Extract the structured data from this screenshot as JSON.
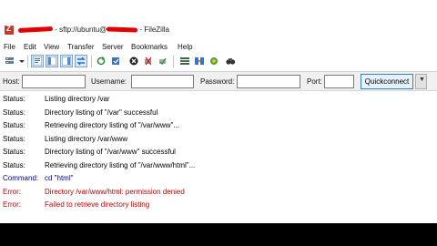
{
  "window": {
    "title_mid": "- sftp://ubuntu@",
    "title_end": "- FileZilla"
  },
  "menu": [
    "File",
    "Edit",
    "View",
    "Transfer",
    "Server",
    "Bookmarks",
    "Help"
  ],
  "toolbar_icons": [
    "site-manager-icon",
    "toggle-message-log-icon",
    "toggle-local-tree-icon",
    "toggle-remote-tree-icon",
    "toggle-transfer-queue-icon",
    "refresh-icon",
    "process-queue-icon",
    "cancel-icon",
    "disconnect-icon",
    "reconnect-icon",
    "filter-icon",
    "compare-icon",
    "sync-browse-icon",
    "search-icon"
  ],
  "quickconnect": {
    "host_label": "Host:",
    "host_value": "",
    "username_label": "Username:",
    "username_value": "",
    "password_label": "Password:",
    "password_value": "",
    "port_label": "Port:",
    "port_value": "",
    "button_label": "Quickconnect"
  },
  "log": [
    {
      "type": "Status:",
      "kind": "status",
      "message": "Listing directory /var"
    },
    {
      "type": "Status:",
      "kind": "status",
      "message": "Directory listing of \"/var\" successful"
    },
    {
      "type": "Status:",
      "kind": "status",
      "message": "Retrieving directory listing of \"/var/www\"..."
    },
    {
      "type": "Status:",
      "kind": "status",
      "message": "Listing directory /var/www"
    },
    {
      "type": "Status:",
      "kind": "status",
      "message": "Directory listing of \"/var/www\" successful"
    },
    {
      "type": "Status:",
      "kind": "status",
      "message": "Retrieving directory listing of \"/var/www/html\"..."
    },
    {
      "type": "Command:",
      "kind": "command",
      "message": "cd \"html\""
    },
    {
      "type": "Error:",
      "kind": "error",
      "message": "Directory /var/www/html: permission denied"
    },
    {
      "type": "Error:",
      "kind": "error",
      "message": "Failed to retrieve directory listing"
    }
  ],
  "colors": {
    "status": "#000000",
    "command": "#00008b",
    "error": "#c00000",
    "redaction": "#e00000"
  }
}
